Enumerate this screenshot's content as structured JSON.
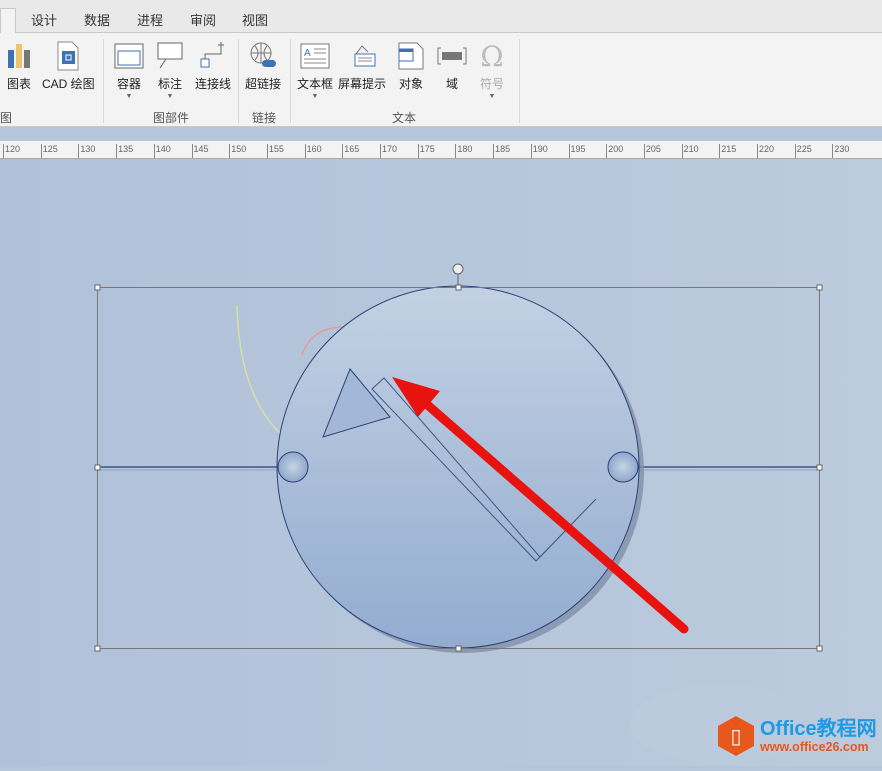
{
  "tabs": [
    "设计",
    "数据",
    "进程",
    "审阅",
    "视图"
  ],
  "ribbon": {
    "buttons": [
      {
        "label": "图表"
      },
      {
        "label": "CAD 绘图"
      },
      {
        "label": "容器"
      },
      {
        "label": "标注"
      },
      {
        "label": "连接线"
      },
      {
        "label": "超链接"
      },
      {
        "label": "文本框"
      },
      {
        "label": "屏幕提示"
      },
      {
        "label": "对象"
      },
      {
        "label": "域"
      },
      {
        "label": "符号"
      }
    ],
    "groups": [
      "图",
      "图部件",
      "链接",
      "文本"
    ]
  },
  "ruler": [
    "120",
    "125",
    "130",
    "135",
    "140",
    "145",
    "150",
    "155",
    "160",
    "165",
    "170",
    "175",
    "180",
    "185",
    "190",
    "195",
    "200",
    "205",
    "210",
    "215",
    "220",
    "225",
    "230"
  ],
  "watermark": {
    "title": "Office教程网",
    "url": "www.office26.com"
  },
  "colors": {
    "arrow": "#e8130f",
    "accent": "#2b579a",
    "logo_orange": "#e8581c",
    "logo_blue": "#1f9be6"
  }
}
